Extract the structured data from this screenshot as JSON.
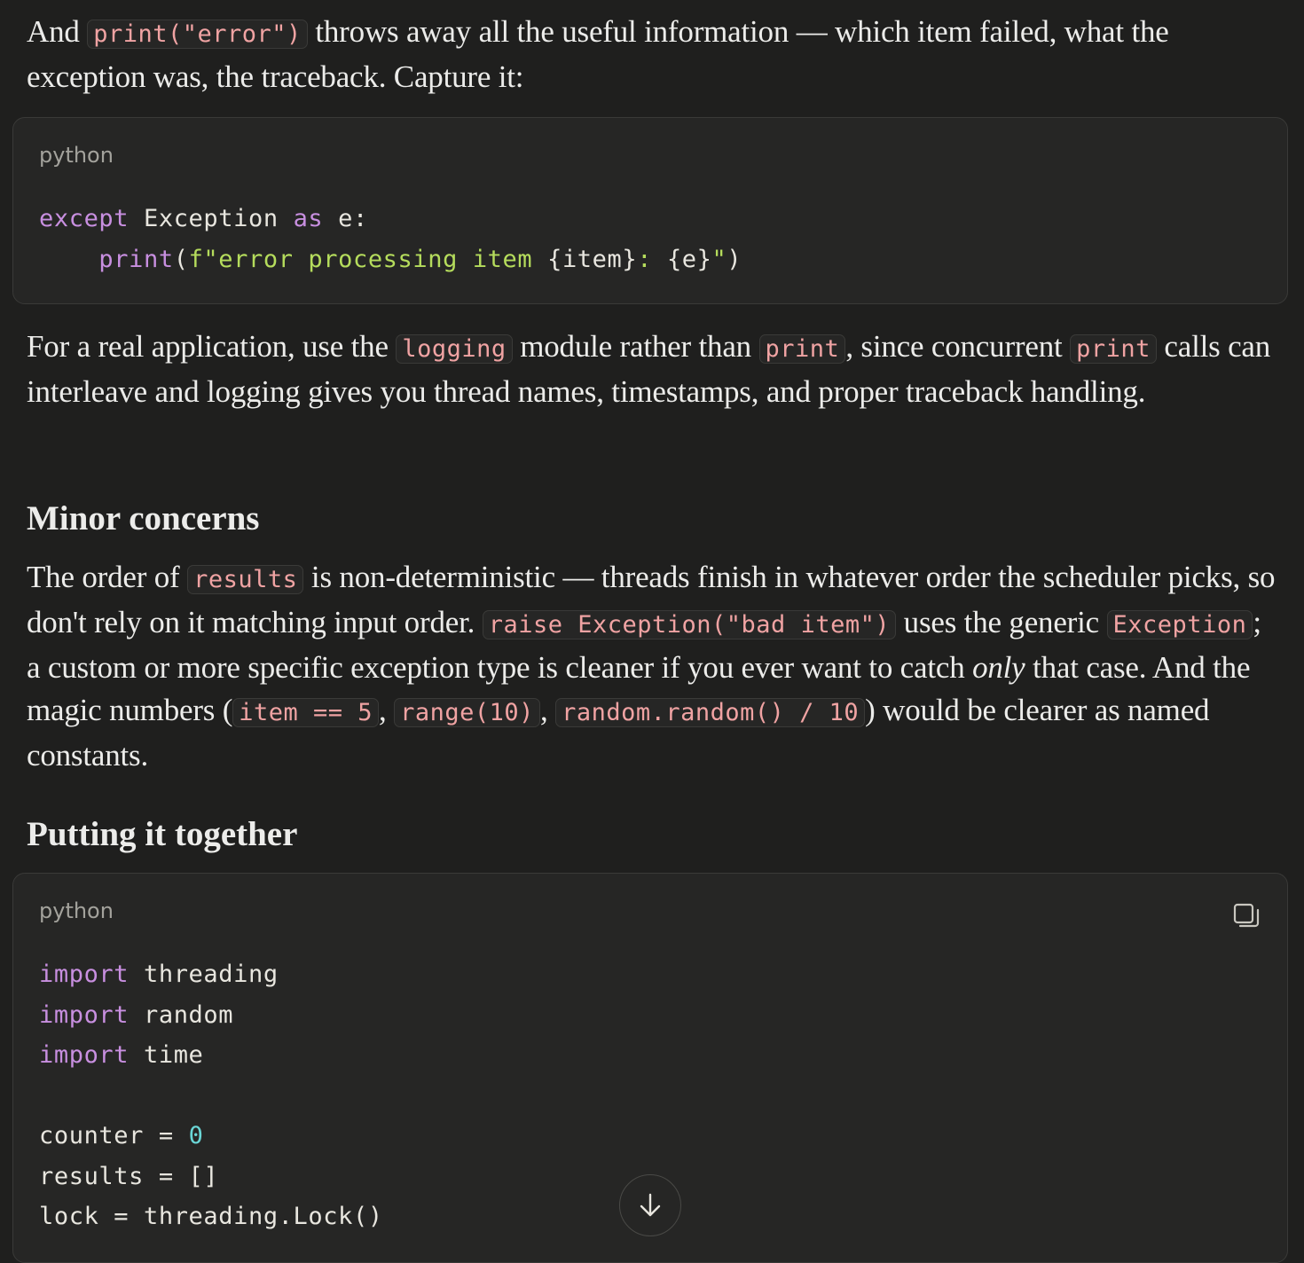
{
  "p1": {
    "t0": "And ",
    "c0": "print(\"error\")",
    "t1": " throws away all the useful information — which item failed, what the exception was, the traceback. Capture it:"
  },
  "code1": {
    "lang": "python",
    "l1_kw": "except",
    "l1_a": " Exception ",
    "l1_kw2": "as",
    "l1_b": " e:",
    "l2_indent": "    ",
    "l2_fn": "print",
    "l2_a": "(",
    "l2_str1": "f\"error processing item ",
    "l2_b": "{item}",
    "l2_str2": ": ",
    "l2_c": "{e}",
    "l2_str3": "\"",
    "l2_d": ")"
  },
  "p2": {
    "t0": "For a real application, use the ",
    "c0": "logging",
    "t1": " module rather than ",
    "c1": "print",
    "t2": ", since concurrent ",
    "c2": "print",
    "t3": " calls can interleave and logging gives you thread names, timestamps, and proper traceback handling."
  },
  "h_minor": "Minor concerns",
  "p3": {
    "t0": "The order of ",
    "c0": "results",
    "t1": " is non-deterministic — threads finish in whatever order the scheduler picks, so don't rely on it matching input order. ",
    "c1": "raise Exception(\"bad item\")",
    "t2": " uses the generic ",
    "c2": "Exception",
    "t3": "; a custom or more specific exception type is cleaner if you ever want to catch ",
    "em": "only",
    "t4": " that case. And the magic numbers (",
    "c3": "item == 5",
    "t5": ", ",
    "c4": "range(10)",
    "t6": ", ",
    "c5": "random.random() / 10",
    "t7": ") would be clearer as named constants."
  },
  "h_put": "Putting it together",
  "code2": {
    "lang": "python",
    "kw_import": "import",
    "m1": " threading",
    "m2": " random",
    "m3": " time",
    "counter": "counter = ",
    "counter_val": "0",
    "results": "results = []",
    "lock": "lock = threading.Lock()"
  },
  "icons": {
    "copy": "copy-icon",
    "scroll": "arrow-down-icon"
  }
}
